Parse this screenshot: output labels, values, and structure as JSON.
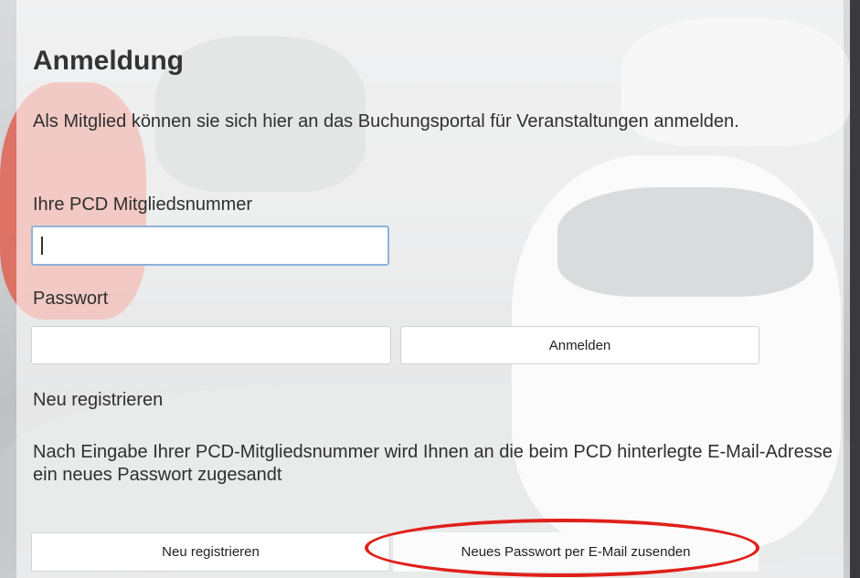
{
  "login": {
    "title": "Anmeldung",
    "description": "Als Mitglied können sie sich hier an das Buchungsportal für Veranstaltungen anmelden.",
    "member_label": "Ihre PCD Mitgliedsnummer",
    "member_value": "",
    "password_label": "Passwort",
    "password_value": "",
    "login_button": "Anmelden"
  },
  "register": {
    "link_label": "Neu registrieren",
    "info_text": "Nach Eingabe Ihrer PCD-Mitgliedsnummer wird Ihnen an die beim PCD hinterlegte E-Mail-Adresse ein neues Passwort zugesandt",
    "register_button": "Neu registrieren",
    "new_password_button": "Neues Passwort per E-Mail zusenden"
  },
  "colors": {
    "highlight": "#e0201a",
    "focus_border": "#8fb3da"
  }
}
